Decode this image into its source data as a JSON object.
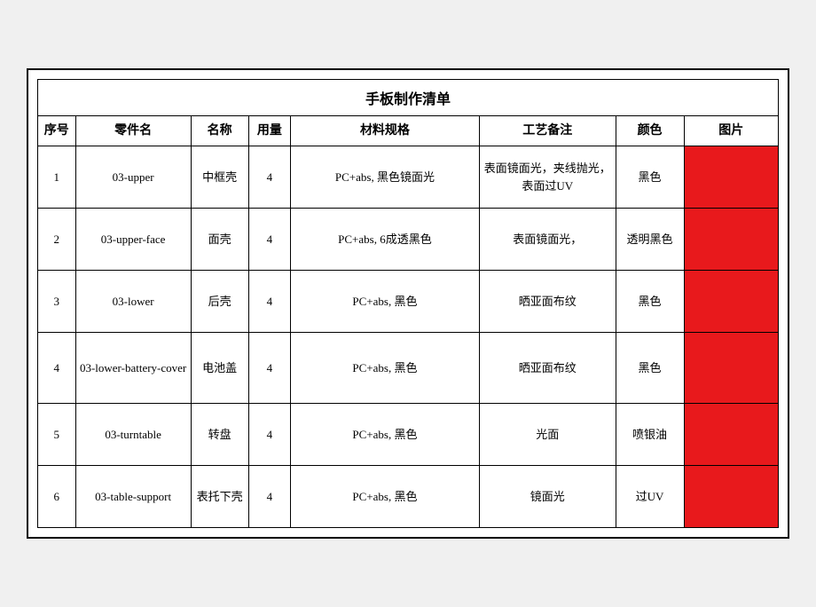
{
  "title": "手板制作清单",
  "headers": {
    "seq": "序号",
    "part_code": "零件名",
    "part_name": "名称",
    "usage": "用量",
    "material": "材料规格",
    "process": "工艺备注",
    "color": "颜色",
    "image": "图片"
  },
  "rows": [
    {
      "seq": "1",
      "part_code": "03-upper",
      "part_name": "中框壳",
      "usage": "4",
      "material": "PC+abs, 黑色镜面光",
      "process": "表面镜面光，夹线抛光，表面过UV",
      "color": "黑色"
    },
    {
      "seq": "2",
      "part_code": "03-upper-face",
      "part_name": "面壳",
      "usage": "4",
      "material": "PC+abs, 6成透黑色",
      "process": "表面镜面光，",
      "color": "透明黑色"
    },
    {
      "seq": "3",
      "part_code": "03-lower",
      "part_name": "后壳",
      "usage": "4",
      "material": "PC+abs, 黑色",
      "process": "晒亚面布纹",
      "color": "黑色"
    },
    {
      "seq": "4",
      "part_code": "03-lower-battery-cover",
      "part_name": "电池盖",
      "usage": "4",
      "material": "PC+abs, 黑色",
      "process": "晒亚面布纹",
      "color": "黑色"
    },
    {
      "seq": "5",
      "part_code": "03-turntable",
      "part_name": "转盘",
      "usage": "4",
      "material": "PC+abs, 黑色",
      "process": "光面",
      "color": "喷银油"
    },
    {
      "seq": "6",
      "part_code": "03-table-support",
      "part_name": "表托下壳",
      "usage": "4",
      "material": "PC+abs, 黑色",
      "process": "镜面光",
      "color": "过UV"
    }
  ]
}
